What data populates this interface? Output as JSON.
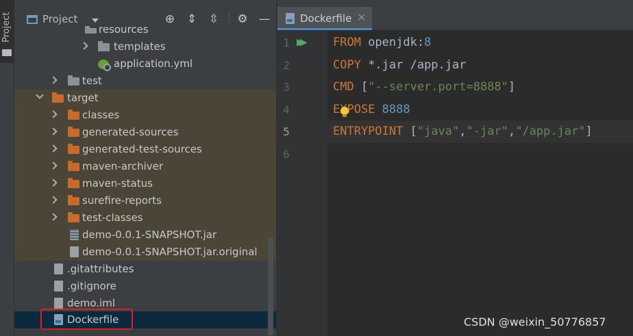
{
  "side_strip": {
    "tab_label": "Project"
  },
  "project_panel": {
    "title": "Project",
    "tree": [
      {
        "label": "resources",
        "icon": "folder-resources-icon"
      },
      {
        "label": "templates",
        "icon": "folder-icon"
      },
      {
        "label": "application.yml",
        "icon": "spring-yml-icon"
      },
      {
        "label": "test",
        "icon": "folder-icon"
      },
      {
        "label": "target",
        "icon": "folder-excluded-icon"
      },
      {
        "label": "classes",
        "icon": "folder-excluded-icon"
      },
      {
        "label": "generated-sources",
        "icon": "folder-excluded-icon"
      },
      {
        "label": "generated-test-sources",
        "icon": "folder-excluded-icon"
      },
      {
        "label": "maven-archiver",
        "icon": "folder-excluded-icon"
      },
      {
        "label": "maven-status",
        "icon": "folder-excluded-icon"
      },
      {
        "label": "surefire-reports",
        "icon": "folder-excluded-icon"
      },
      {
        "label": "test-classes",
        "icon": "folder-excluded-icon"
      },
      {
        "label": "demo-0.0.1-SNAPSHOT.jar",
        "icon": "jar-file-icon"
      },
      {
        "label": "demo-0.0.1-SNAPSHOT.jar.original",
        "icon": "unknown-file-icon"
      },
      {
        "label": ".gitattributes",
        "icon": "git-file-icon"
      },
      {
        "label": ".gitignore",
        "icon": "git-file-icon"
      },
      {
        "label": "demo.iml",
        "icon": "iml-file-icon"
      },
      {
        "label": "Dockerfile",
        "icon": "docker-file-icon"
      }
    ]
  },
  "editor": {
    "tab_label": "Dockerfile",
    "line_numbers": [
      "1",
      "2",
      "3",
      "4",
      "5",
      "6"
    ],
    "lines": {
      "l1": {
        "kw": "FROM",
        "rest": " openjdk:",
        "num": "8"
      },
      "l2": {
        "kw": "COPY",
        "rest": " *.jar /app.jar"
      },
      "l3": {
        "kw": "CMD",
        "open": " [",
        "str": "\"--server.port=8888\"",
        "close": "]"
      },
      "l4": {
        "kw": "EXPOSE",
        "num": " 8888"
      },
      "l5": {
        "kw": "ENTRYPOINT",
        "open": " [",
        "s1": "\"java\"",
        "c1": ",",
        "s2": "\"-jar\"",
        "c2": ",",
        "s3": "\"/app.jar\"",
        "close": "]"
      }
    }
  },
  "watermark": "CSDN @weixin_50776857",
  "colors": {
    "keyword": "#cc7832",
    "number": "#6897bb",
    "string": "#6a8759",
    "selection_outline": "#e0201a"
  }
}
